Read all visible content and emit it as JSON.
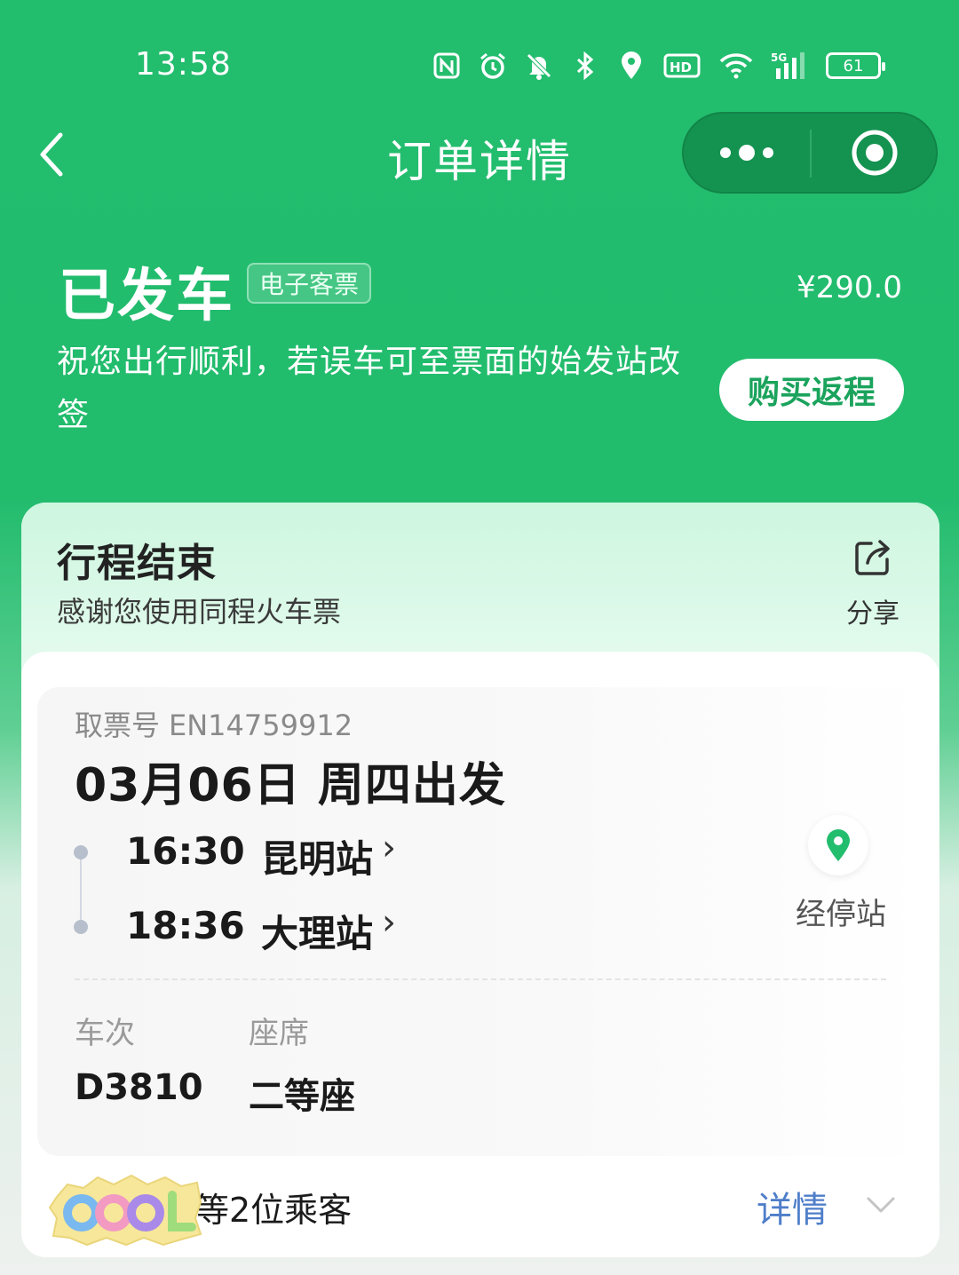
{
  "status_bar": {
    "time": "13:58",
    "battery": "61"
  },
  "nav": {
    "title": "订单详情"
  },
  "order": {
    "status": "已发车",
    "ticket_type": "电子客票",
    "price": "¥290.0",
    "wish": "祝您出行顺利，若误车可至票面的始发站改签",
    "return_button": "购买返程"
  },
  "journey": {
    "title": "行程结束",
    "subtitle": "感谢您使用同程火车票",
    "share_label": "分享"
  },
  "ticket": {
    "pickup_label": "取票号",
    "pickup_code": "EN14759912",
    "departure_date": "03月06日 周四出发",
    "from": {
      "time": "16:30",
      "station": "昆明站"
    },
    "to": {
      "time": "18:36",
      "station": "大理站"
    },
    "stops_label": "经停站",
    "train_label": "车次",
    "train_no": "D3810",
    "seat_label": "座席",
    "seat_class": "二等座"
  },
  "passengers": {
    "summary": "等2位乘客",
    "details_label": "详情"
  },
  "sticker": {
    "text": "COOL"
  },
  "colors": {
    "brand_green": "#23bd6e",
    "link_blue": "#4f7ec9"
  }
}
